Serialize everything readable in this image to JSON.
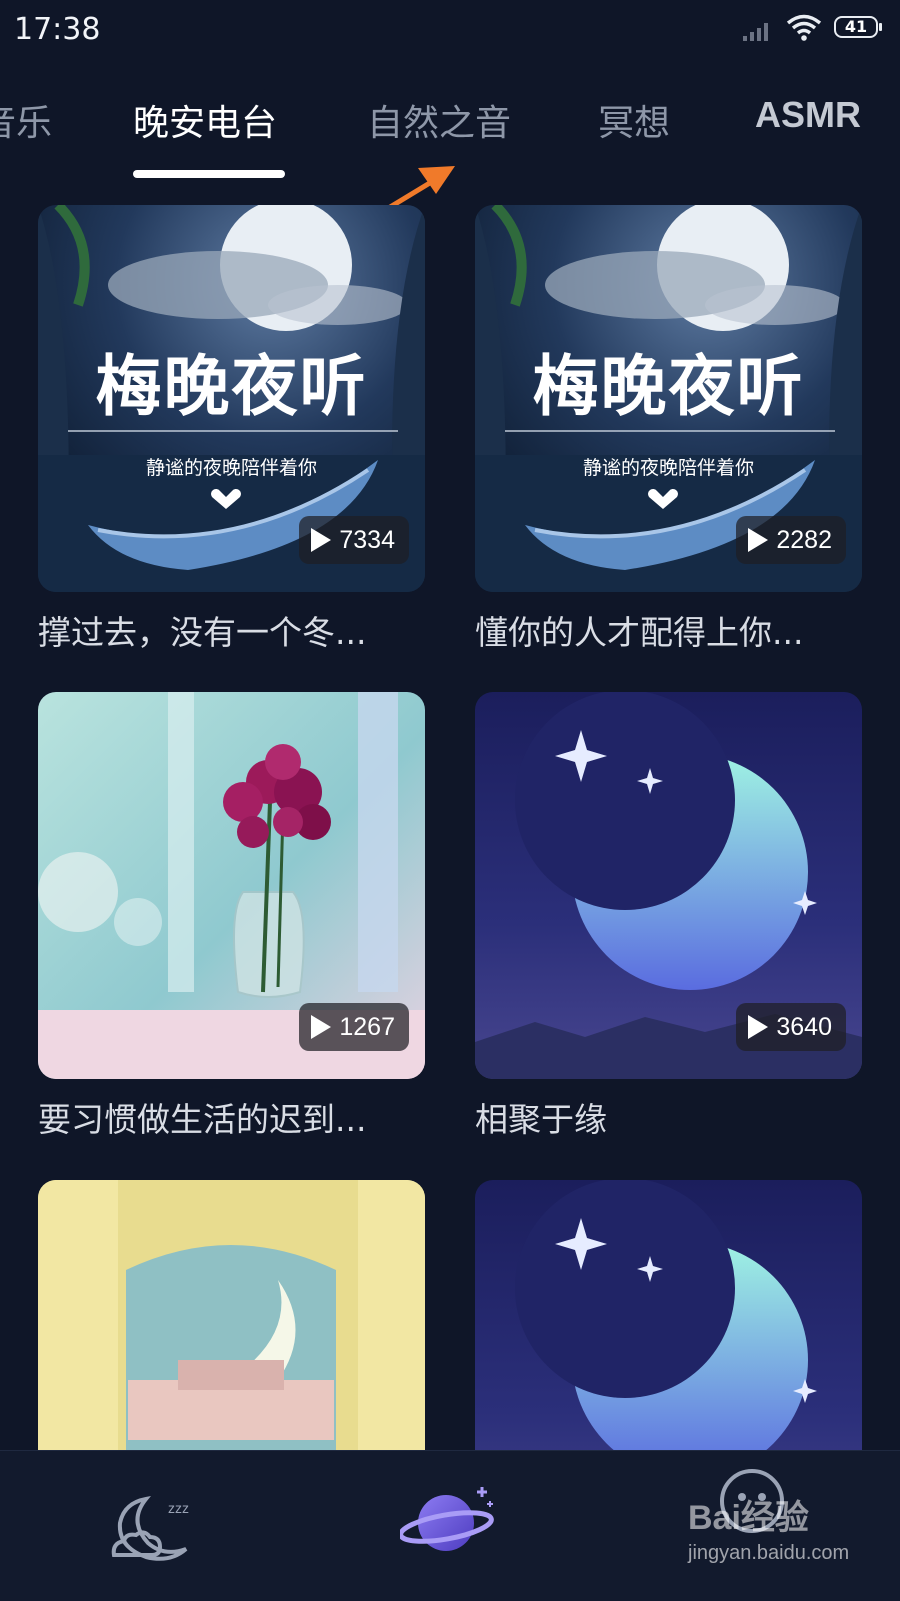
{
  "status_bar": {
    "time": "17:38",
    "battery": "41",
    "icons": [
      "signal-icon",
      "wifi-icon",
      "battery-icon"
    ]
  },
  "tabs": [
    {
      "label": "音乐",
      "active": false
    },
    {
      "label": "晚安电台",
      "active": true
    },
    {
      "label": "自然之音",
      "active": false
    },
    {
      "label": "冥想",
      "active": false
    },
    {
      "label": "ASMR",
      "active": false
    }
  ],
  "cards": [
    {
      "title": "撑过去，没有一个冬...",
      "plays": "7334",
      "thumb_title": "梅晚夜听",
      "thumb_subtitle": "静谧的夜晚陪伴着你",
      "thumb": "night-lake-boat"
    },
    {
      "title": "懂你的人才配得上你...",
      "plays": "2282",
      "thumb_title": "梅晚夜听",
      "thumb_subtitle": "静谧的夜晚陪伴着你",
      "thumb": "night-lake-boat"
    },
    {
      "title": "要习惯做生活的迟到...",
      "plays": "1267",
      "thumb": "flower-vase"
    },
    {
      "title": "相聚于缘",
      "plays": "3640",
      "thumb": "crescent-moon-stars"
    },
    {
      "title": "",
      "plays": "",
      "thumb": "window-moon"
    },
    {
      "title": "",
      "plays": "",
      "thumb": "crescent-moon-stars"
    }
  ],
  "bottom_nav": [
    {
      "icon": "sleep-moon-icon",
      "active": false
    },
    {
      "icon": "planet-icon",
      "active": true
    },
    {
      "icon": "profile-icon",
      "active": false
    }
  ],
  "watermark": {
    "line1": "Bai经验",
    "line2": "jingyan.baidu.com"
  },
  "colors": {
    "background": "#0f1628",
    "tab_active": "#ffffff",
    "tab_inactive": "#8e97a8",
    "arrow": "#f07a2a"
  }
}
